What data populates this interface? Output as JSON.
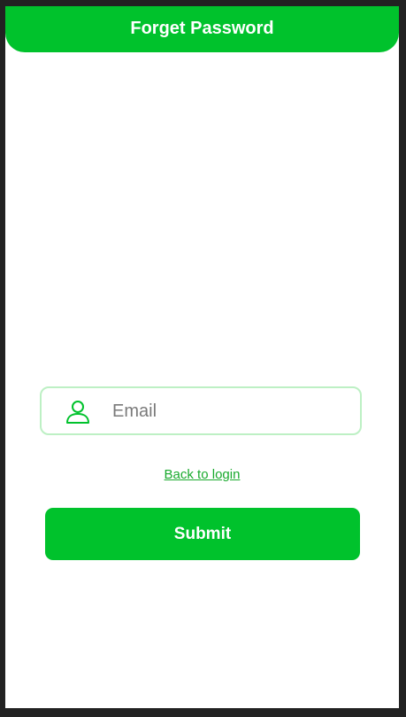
{
  "header": {
    "title": "Forget Password"
  },
  "form": {
    "email": {
      "icon": "user-icon",
      "placeholder": "Email",
      "value": ""
    },
    "back_link_label": "Back to login",
    "submit_label": "Submit"
  },
  "colors": {
    "primary": "#00c22c",
    "link": "#1aaa2e",
    "input_border": "#bdf0c4",
    "frame_background": "#222222"
  }
}
